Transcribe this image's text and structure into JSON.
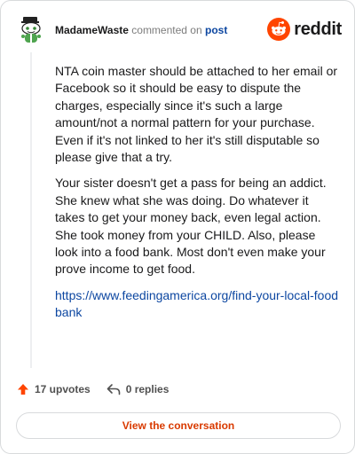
{
  "header": {
    "username": "MadameWaste",
    "commented_on": "commented on",
    "post_link": "post",
    "brand": "reddit"
  },
  "comment": {
    "paragraphs": [
      "NTA coin master should be attached to her email or Facebook so it should be easy to dispute the charges, especially since it's such a large amount/not a normal pattern for your purchase. Even if it's not linked to her it's still disputable so please give that a try.",
      "Your sister doesn't get a pass for being an addict. She knew what she was doing. Do whatever it takes to get your money back, even legal action. She took money from your CHILD. Also, please look into a food bank. Most don't even make your prove income to get food."
    ],
    "link": "https://www.feedingamerica.org/find-your-local-foodbank"
  },
  "stats": {
    "upvotes": "17 upvotes",
    "replies": "0 replies"
  },
  "cta": {
    "label": "View the conversation"
  },
  "colors": {
    "reddit_orange": "#ff4500",
    "link_blue": "#0d47a1",
    "cta_text": "#d93a00"
  },
  "icons": {
    "avatar": "snoo-avatar-icon",
    "brand": "reddit-logo-icon",
    "upvote": "upvote-arrow-icon",
    "reply": "reply-arrow-icon"
  }
}
